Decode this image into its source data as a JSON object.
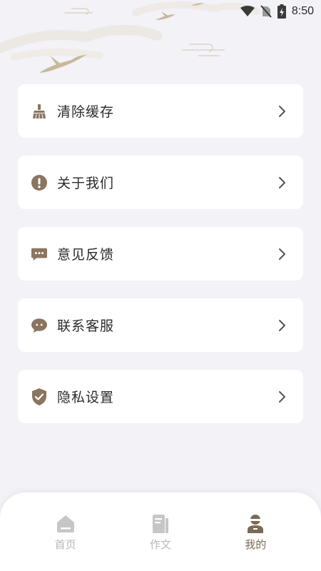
{
  "status_bar": {
    "time": "8:50",
    "icons": [
      "wifi-icon",
      "no-sim-icon",
      "battery-charging-icon"
    ]
  },
  "menu": [
    {
      "label": "清除缓存",
      "icon": "broom-icon"
    },
    {
      "label": "关于我们",
      "icon": "exclamation-circle-icon"
    },
    {
      "label": "意见反馈",
      "icon": "chat-dots-icon"
    },
    {
      "label": "联系客服",
      "icon": "chat-bubble-icon"
    },
    {
      "label": "隐私设置",
      "icon": "shield-check-icon"
    }
  ],
  "bottom_nav": {
    "items": [
      {
        "label": "首页",
        "icon": "home-icon",
        "active": false
      },
      {
        "label": "作文",
        "icon": "document-icon",
        "active": false
      },
      {
        "label": "我的",
        "icon": "user-icon",
        "active": true
      }
    ]
  },
  "colors": {
    "background": "#f3f2f7",
    "card": "#ffffff",
    "accent": "#8a7560",
    "text": "#2a2a2a",
    "nav_inactive": "#c6c6c6"
  }
}
